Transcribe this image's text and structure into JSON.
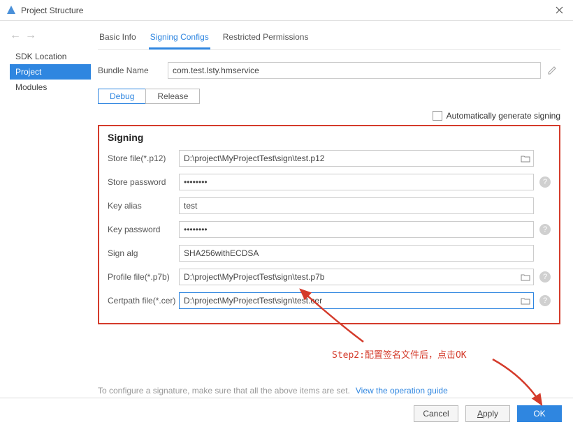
{
  "window": {
    "title": "Project Structure"
  },
  "sidebar": {
    "items": [
      {
        "label": "SDK Location"
      },
      {
        "label": "Project"
      },
      {
        "label": "Modules"
      }
    ]
  },
  "tabs": [
    {
      "label": "Basic Info"
    },
    {
      "label": "Signing Configs"
    },
    {
      "label": "Restricted Permissions"
    }
  ],
  "bundle": {
    "label": "Bundle Name",
    "value": "com.test.lsty.hmservice"
  },
  "subtabs": [
    {
      "label": "Debug"
    },
    {
      "label": "Release"
    }
  ],
  "auto_label": "Automatically generate signing",
  "signing": {
    "title": "Signing",
    "fields": {
      "store_file": {
        "label": "Store file(*.p12)",
        "value": "D:\\project\\MyProjectTest\\sign\\test.p12"
      },
      "store_password": {
        "label": "Store password",
        "value": "••••••••"
      },
      "key_alias": {
        "label": "Key alias",
        "value": "test"
      },
      "key_password": {
        "label": "Key password",
        "value": "••••••••"
      },
      "sign_alg": {
        "label": "Sign alg",
        "value": "SHA256withECDSA"
      },
      "profile_file": {
        "label": "Profile file(*.p7b)",
        "value": "D:\\project\\MyProjectTest\\sign\\test.p7b"
      },
      "certpath_file": {
        "label": "Certpath file(*.cer)",
        "value": "D:\\project\\MyProjectTest\\sign\\test.cer"
      }
    }
  },
  "help": {
    "text": "To configure a signature, make sure that all the above items are set.",
    "link": "View the operation guide"
  },
  "footer": {
    "cancel": "Cancel",
    "apply": "Apply",
    "ok": "OK"
  },
  "annotation": {
    "step2": "Step2:配置签名文件后，点击OK"
  }
}
